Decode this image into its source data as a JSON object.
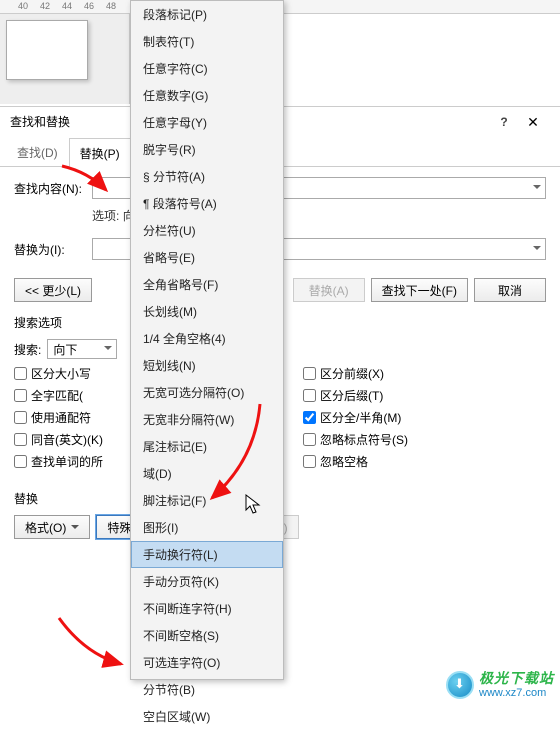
{
  "ruler": {
    "t40": "40",
    "t42": "42",
    "t44": "44",
    "t46": "46",
    "t48": "48"
  },
  "dialog": {
    "title": "查找和替换",
    "help": "?",
    "close": "✕",
    "tabs": {
      "find": "查找(D)",
      "replace": "替换(P)"
    },
    "find_label": "查找内容(N):",
    "options_label": "选项:",
    "options_value": "向下",
    "replace_label": "替换为(I):",
    "less_btn": "<< 更少(L)",
    "replace_one_btn": "替换(A)",
    "find_next_btn": "查找下一处(F)",
    "cancel_btn": "取消",
    "search_options": "搜索选项",
    "search_label": "搜索:",
    "search_dir": "向下",
    "chk_case": "区分大小写",
    "chk_whole": "全字匹配(",
    "chk_wildcard": "使用通配符",
    "chk_homophone": "同音(英文)(K)",
    "chk_wordforms": "查找单词的所",
    "chk_prefix": "区分前缀(X)",
    "chk_suffix": "区分后缀(T)",
    "chk_fullhalf": "区分全/半角(M)",
    "chk_punct": "忽略标点符号(S)",
    "chk_space": "忽略空格",
    "replace_section": "替换",
    "format_btn": "格式(O)",
    "special_btn": "特殊格式(E)",
    "noformat_btn": "不限定格式(T)"
  },
  "menu": {
    "items": [
      "段落标记(P)",
      "制表符(T)",
      "任意字符(C)",
      "任意数字(G)",
      "任意字母(Y)",
      "脱字号(R)",
      "§ 分节符(A)",
      "¶ 段落符号(A)",
      "分栏符(U)",
      "省略号(E)",
      "全角省略号(F)",
      "长划线(M)",
      "1/4 全角空格(4)",
      "短划线(N)",
      "无宽可选分隔符(O)",
      "无宽非分隔符(W)",
      "尾注标记(E)",
      "域(D)",
      "脚注标记(F)",
      "图形(I)",
      "手动换行符(L)",
      "手动分页符(K)",
      "不间断连字符(H)",
      "不间断空格(S)",
      "可选连字符(O)",
      "分节符(B)",
      "空白区域(W)"
    ],
    "highlighted": 20
  },
  "watermark": {
    "cn": "极光下载站",
    "url": "www.xz7.com"
  }
}
